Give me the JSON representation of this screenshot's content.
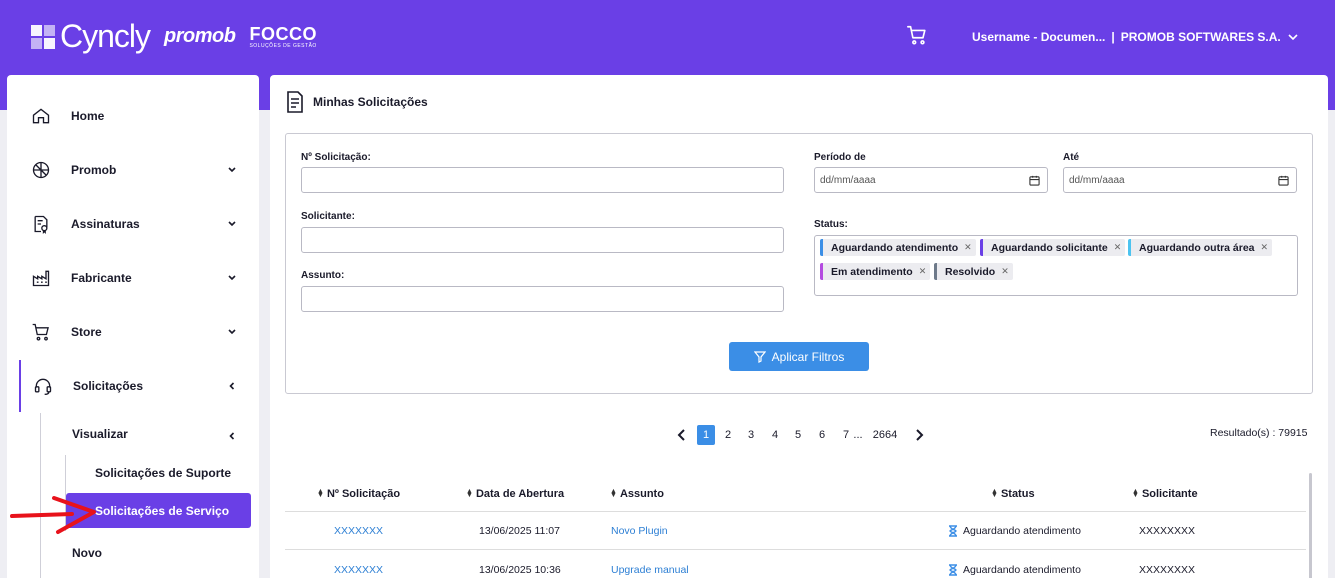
{
  "brand": {
    "cyncly": "Cyncly",
    "promob": "promob",
    "focco": "FOCCO",
    "focco_sub": "SOLUÇÕES DE GESTÃO"
  },
  "header": {
    "user": "Username - Documen...",
    "separator": "|",
    "company": "PROMOB SOFTWARES S.A."
  },
  "sidebar": {
    "items": [
      {
        "label": "Home"
      },
      {
        "label": "Promob"
      },
      {
        "label": "Assinaturas"
      },
      {
        "label": "Fabricante"
      },
      {
        "label": "Store"
      },
      {
        "label": "Solicitações"
      }
    ],
    "sub": {
      "visualizar": "Visualizar",
      "suporte": "Solicitações de Suporte",
      "servico": "Solicitações de Serviço",
      "novo": "Novo"
    }
  },
  "page": {
    "title": "Minhas Solicitações"
  },
  "filters": {
    "num_label": "Nº Solicitação:",
    "solicitante_label": "Solicitante:",
    "assunto_label": "Assunto:",
    "periodo_label": "Período de",
    "ate_label": "Até",
    "date_placeholder": "dd/mm/aaaa",
    "status_label": "Status:",
    "status_tags": [
      {
        "label": "Aguardando atendimento",
        "color": "#3b8ee6"
      },
      {
        "label": "Aguardando solicitante",
        "color": "#6a3fe6"
      },
      {
        "label": "Aguardando outra área",
        "color": "#4cc3f0"
      },
      {
        "label": "Em atendimento",
        "color": "#b44be0"
      },
      {
        "label": "Resolvido",
        "color": "#6e7a8a"
      }
    ],
    "apply_label": "Aplicar Filtros"
  },
  "pagination": {
    "pages": [
      "1",
      "2",
      "3",
      "4",
      "5",
      "6",
      "7"
    ],
    "ellipsis": "...",
    "last": "2664",
    "current": "1"
  },
  "results": "Resultado(s) : 79915",
  "table": {
    "headers": [
      "Nº Solicitação",
      "Data de Abertura",
      "Assunto",
      "Status",
      "Solicitante"
    ],
    "rows": [
      {
        "num": "XXXXXXX",
        "date": "13/06/2025 11:07",
        "subject": "Novo Plugin",
        "status": "Aguardando atendimento",
        "requester": "XXXXXXXX"
      },
      {
        "num": "XXXXXXX",
        "date": "13/06/2025 10:36",
        "subject": "Upgrade manual",
        "status": "Aguardando atendimento",
        "requester": "XXXXXXXX"
      }
    ]
  },
  "colors": {
    "accent": "#6a3fe6",
    "button": "#3b8ee6",
    "link": "#2d7fd4",
    "annotation_arrow": "#e8121b"
  }
}
